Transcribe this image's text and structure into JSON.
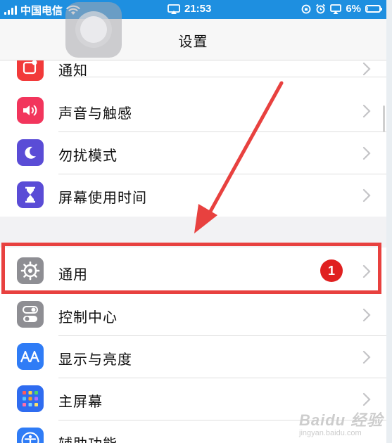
{
  "status_bar": {
    "carrier": "中国电信",
    "time": "21:53",
    "battery": "6%",
    "battery_level": 0.06
  },
  "nav": {
    "title": "设置"
  },
  "settings": [
    {
      "label": "通知",
      "icon": "notification-icon",
      "color": "#f23a3a"
    },
    {
      "label": "声音与触感",
      "icon": "speaker-icon",
      "color": "#f2355c"
    },
    {
      "label": "勿扰模式",
      "icon": "moon-icon",
      "color": "#5a4cd6"
    },
    {
      "label": "屏幕使用时间",
      "icon": "hourglass-icon",
      "color": "#5a4cd6"
    },
    {
      "label": "通用",
      "icon": "gear-icon",
      "color": "#8e8e93",
      "badge": "1"
    },
    {
      "label": "控制中心",
      "icon": "toggle-icon",
      "color": "#8e8e93"
    },
    {
      "label": "显示与亮度",
      "icon": "text-size-icon",
      "color": "#2f7cf6"
    },
    {
      "label": "主屏幕",
      "icon": "home-screen-icon",
      "color": "#2f6cf0"
    },
    {
      "label": "辅助功能",
      "icon": "accessibility-icon",
      "color": "#2f7cf6"
    }
  ],
  "annotation": {
    "badge_text": "1",
    "color": "#e8413f"
  },
  "watermark": {
    "title": "Baidu 经验",
    "sub": "jingyan.baidu.com"
  }
}
